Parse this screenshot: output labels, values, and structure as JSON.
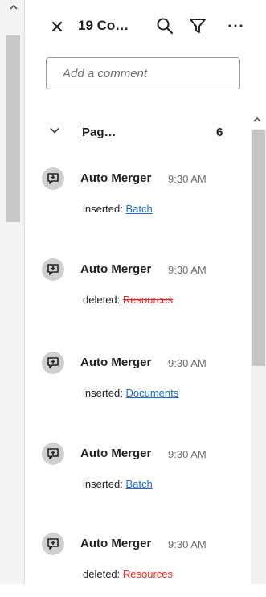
{
  "header": {
    "title": "19 Co…"
  },
  "add_comment": {
    "placeholder": "Add a comment"
  },
  "group": {
    "label": "Pag…",
    "count": "6"
  },
  "comments": [
    {
      "author": "Auto Merger",
      "time": "9:30 AM",
      "action": "inserted:",
      "text": "Batch",
      "kind": "inserted"
    },
    {
      "author": "Auto Merger",
      "time": "9:30 AM",
      "action": "deleted:",
      "text": "Resources",
      "kind": "deleted"
    },
    {
      "author": "Auto Merger",
      "time": "9:30 AM",
      "action": "inserted:",
      "text": "Documents",
      "kind": "inserted"
    },
    {
      "author": "Auto Merger",
      "time": "9:30 AM",
      "action": "inserted:",
      "text": "Batch",
      "kind": "inserted"
    },
    {
      "author": "Auto Merger",
      "time": "9:30 AM",
      "action": "deleted:",
      "text": "Resources",
      "kind": "deleted"
    }
  ],
  "icons": {
    "close": "close-icon",
    "search": "search-icon",
    "filter": "filter-icon",
    "more": "more-icon",
    "chevron": "chevron-down-icon",
    "comment": "comment-icon"
  },
  "colors": {
    "inserted": "#1c6ddb",
    "deleted": "#e02b2b"
  }
}
